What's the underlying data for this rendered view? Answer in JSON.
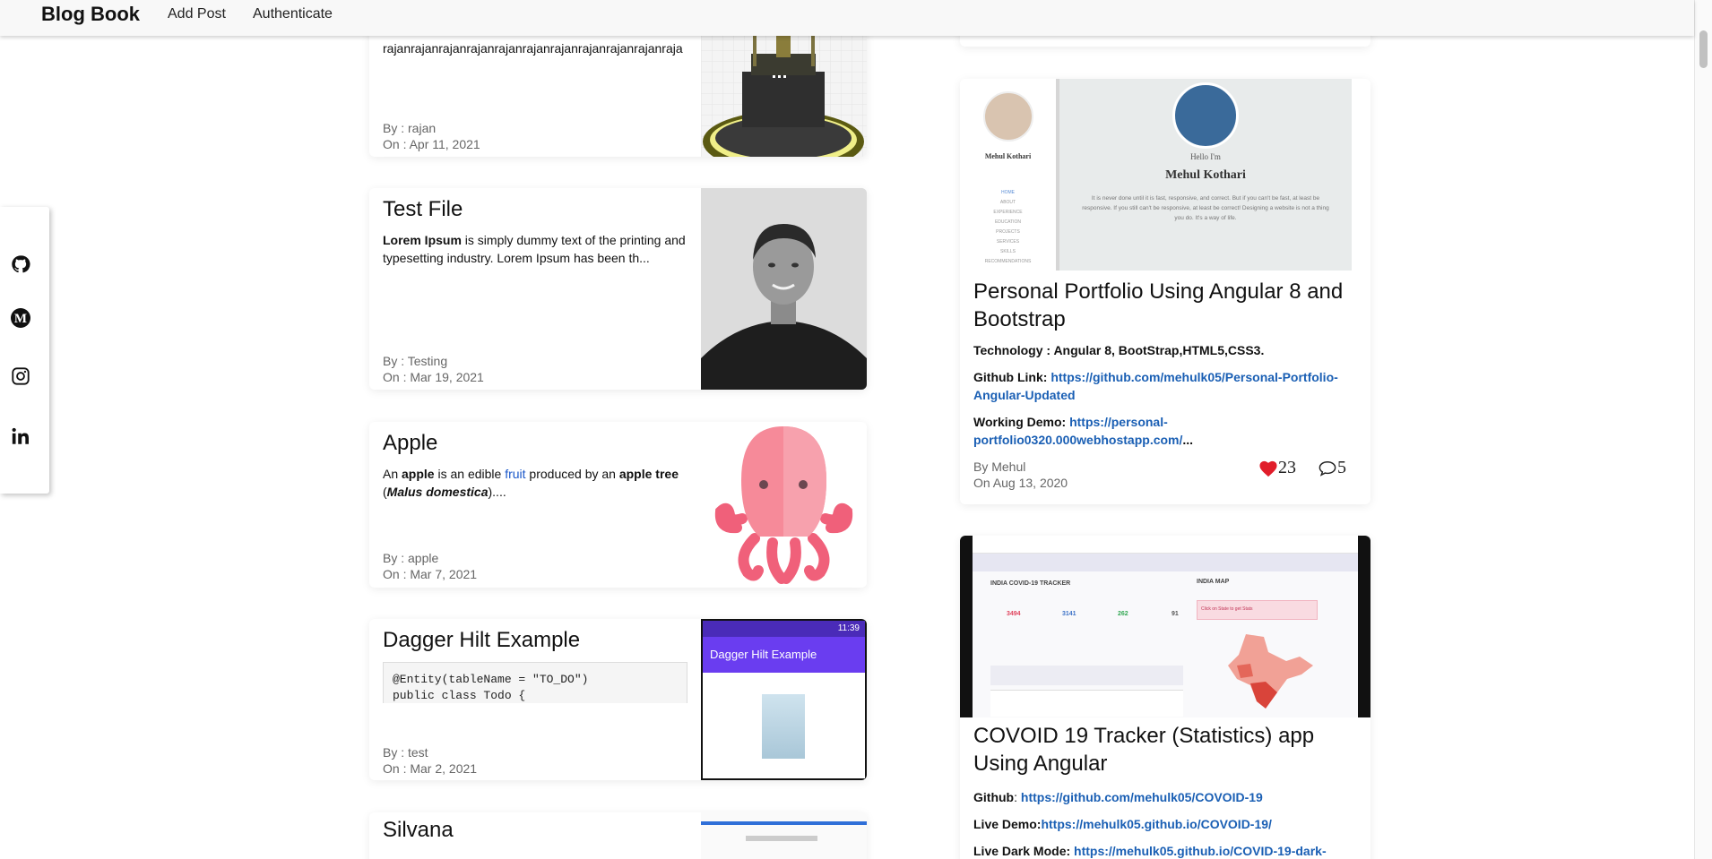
{
  "navbar": {
    "brand": "Blog Book",
    "links": [
      "Add Post",
      "Authenticate"
    ]
  },
  "social": [
    "github-icon",
    "medium-icon",
    "instagram-icon",
    "linkedin-icon"
  ],
  "left_posts": [
    {
      "title": "",
      "excerpt": "rajanrajanrajanrajanrajanrajanrajanrajanrajanrajanraja",
      "by": "By : rajan",
      "on": "On : Apr 11, 2021"
    },
    {
      "title": "Test File",
      "excerpt_bold": "Lorem Ipsum",
      "excerpt": " is simply dummy text of the printing and typesetting industry. Lorem Ipsum has been th...",
      "by": "By : Testing",
      "on": "On : Mar 19, 2021"
    },
    {
      "title": "Apple",
      "parts": [
        "An ",
        "apple",
        " is an edible ",
        "fruit",
        " produced by an ",
        "apple tree",
        " (",
        "Malus domestica",
        ")...."
      ],
      "by": "By : apple",
      "on": "On : Mar 7, 2021"
    },
    {
      "title": "Dagger Hilt Example",
      "code": [
        "@Entity(tableName = \"TO_DO\")",
        "public class Todo {"
      ],
      "by": "By : test",
      "on": "On : Mar 2, 2021",
      "phone_title": "Dagger Hilt Example",
      "phone_time": "11:39"
    },
    {
      "title": "Silvana"
    }
  ],
  "right_posts": [
    {
      "preview": {
        "name": "Mehul Kothari",
        "hello": "Hello I'm",
        "tagline": "It is never done until it is fast, responsive, and correct. But if you can't be fast, at least be responsive. If you still can't be responsive, at least be correct! Designing a website is not a thing you do. It's a way of life.",
        "sidebar_name": "Mehul Kothari",
        "menu": [
          "HOME",
          "ABOUT",
          "EXPERIENCE",
          "EDUCATION",
          "PROJECTS",
          "SERVICES",
          "SKILLS",
          "RECOMMENDATIONS"
        ]
      },
      "title": "Personal Portfolio Using Angular 8 and Bootstrap",
      "tech": "Technology : Angular 8, BootStrap,HTML5,CSS3.",
      "github_label": "Github Link:",
      "github_url": "https://github.com/mehulk05/Personal-Portfolio-Angular-Updated",
      "demo_label": "Working Demo:",
      "demo_url": "https://personal-portfolio0320.000webhostapp.com/",
      "demo_suffix": "...",
      "by": "By Mehul",
      "on": "On Aug 13, 2020",
      "likes": "23",
      "comments": "5"
    },
    {
      "preview": {
        "tracker_title": "INDIA COVID-19 TRACKER",
        "map_title": "INDIA MAP",
        "stats": [
          "3494",
          "3141",
          "262",
          "91"
        ],
        "click_hint": "Click on State to get Stats"
      },
      "title": "COVOID 19 Tracker (Statistics) app Using Angular",
      "github_label": "Github",
      "github_url": "https://github.com/mehulk05/COVOID-19",
      "live_label": "Live Demo:",
      "live_url": "https://mehulk05.github.io/COVOID-19/",
      "dark_label": "Live Dark Mode:",
      "dark_url": "https://mehulk05.github.io/COVID-19-dark-"
    }
  ]
}
